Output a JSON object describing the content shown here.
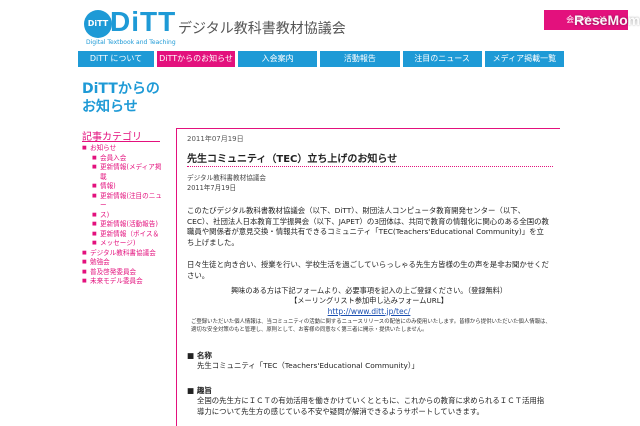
{
  "header": {
    "logo_badge": "DiTT",
    "logo_text": "DiTT",
    "logo_subtitle": "Digital Textbook and Teaching",
    "org_name": "デジタル教科書教材協議会",
    "member_button": "会員ページ",
    "watermark": "ReseMom"
  },
  "nav": {
    "items": [
      {
        "label": "DiTT について"
      },
      {
        "label": "DiTTからのお知らせ"
      },
      {
        "label": "入会案内"
      },
      {
        "label": "活動報告"
      },
      {
        "label": "注目のニュース"
      },
      {
        "label": "メディア掲載一覧"
      }
    ]
  },
  "sidebar": {
    "title_line1": "DiTTからの",
    "title_line2": "お知らせ",
    "category_title": "記事カテゴリ",
    "categories": [
      {
        "label": "お知らせ"
      },
      {
        "label": "会員入会"
      },
      {
        "label": "更新情報(メディア掲載"
      },
      {
        "label": "情報)"
      },
      {
        "label": "更新情報(注目のニュー"
      },
      {
        "label": "ス)"
      },
      {
        "label": "更新情報(活動報告)"
      },
      {
        "label": "更新情報（ポイス＆"
      },
      {
        "label": "メッセージ)"
      },
      {
        "label": "デジタル教科書協議会"
      },
      {
        "label": "勉強会"
      },
      {
        "label": "普及啓発委員会"
      },
      {
        "label": "未来モデル委員会"
      }
    ]
  },
  "post": {
    "date": "2011年07月19日",
    "title": "先生コミュニティ（TEC）立ち上げのお知らせ",
    "author": "デジタル教科書教材協議会",
    "author_date": "2011年7月19日",
    "para1": "このたびデジタル教科書教材協議会（以下、DiTT）、財団法人コンピュータ教育開発センター（以下、CEC）、社団法人日本教育工学振興会（以下、JAPET）の3団体は、共同で教育の情報化に関心のある全国の教職員や関係者が意見交換・情報共有できるコミュニティ「TEC(Teachers'Educational Community)」を立ち上げました。",
    "para2": "日々生徒と向き合い、授業を行い、学校生活を過ごしていらっしゃる先生方皆様の生の声を是非お聞かせください。",
    "signup_line1": "興味のある方は下記フォームより、必要事項を記入の上ご登録ください。（登録無料）",
    "signup_line2": "【メーリングリスト参加申し込みフォームURL】",
    "signup_url": "http://www.ditt.jp/tec/",
    "fine_print": "ご登録いただいた個人情報は、当コミュニティの活動に関するニュースリリースの配信にのみ使用いたします。皆様から提供いただいた個人情報は、適切な安全対策のもと管理し、原則として、お客様の同意なく第三者に開示・提供いたしません。",
    "section1_head": "■ 名称",
    "section1_body": "先生コミュニティ「TEC（Teachers'Educational Community）」",
    "section2_head": "■ 趣旨",
    "section2_body": "全国の先生方にＩＣＴの有効活用を働きかけていくとともに、これからの教育に求められるＩＣＴ活用指導力について先生方の感じている不安や疑問が解消できるようサポートしていきます。"
  },
  "colors": {
    "brand_blue": "#1e9ad6",
    "accent_magenta": "#e3117d"
  }
}
